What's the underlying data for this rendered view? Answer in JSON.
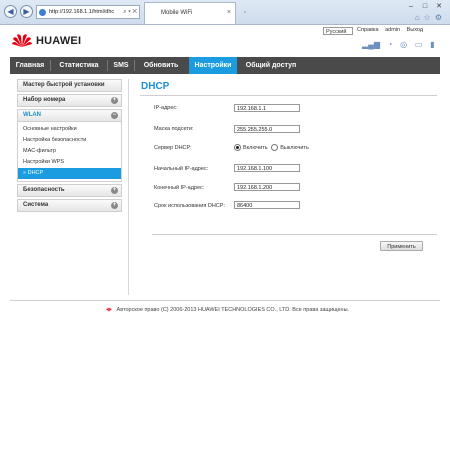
{
  "browser": {
    "address": "http://192.168.1.1/html/dhc",
    "tab_title": "Mobile WiFi",
    "minimize": "–",
    "maximize": "□",
    "close": "✕"
  },
  "header": {
    "logo_text": "HUAWEI",
    "language": "Русский",
    "links": [
      "Справка",
      "admin",
      "Выход"
    ]
  },
  "menu": [
    {
      "label": "Главная",
      "active": false
    },
    {
      "label": "Статистика",
      "active": false
    },
    {
      "label": "SMS",
      "active": false
    },
    {
      "label": "Обновить",
      "active": false
    },
    {
      "label": "Настройки",
      "active": true
    },
    {
      "label": "Общий доступ",
      "active": false
    }
  ],
  "sidebar": {
    "quick_setup": "Мастер быстрой установки",
    "dial": "Набор номера",
    "wlan": "WLAN",
    "wlan_items": [
      "Основные настройки",
      "Настройка безопасности",
      "MAC-фильтр",
      "Настройки WPS",
      "DHCP"
    ],
    "security": "Безопасность",
    "system": "Система"
  },
  "content": {
    "title": "DHCP",
    "ip_label": "IP-адрес:",
    "ip_value": "192.168.1.1",
    "mask_label": "Маска подсети:",
    "mask_value": "255.255.255.0",
    "dhcp_label": "Сервер DHCP:",
    "dhcp_on": "Включить",
    "dhcp_off": "Выключить",
    "start_label": "Начальный IP-адрес:",
    "start_value": "192.168.1.100",
    "end_label": "Конечный IP-адрес:",
    "end_value": "192.168.1.200",
    "lease_label": "Срок использования DHCP:",
    "lease_value": "86400",
    "apply": "Применить"
  },
  "footer": {
    "copyright": "Авторское право (C) 2006-2013 HUAWEI TECHNOLOGIES CO., LTD. Все права защищены."
  },
  "colors": {
    "accent": "#1b9be0",
    "menu_bg": "#4a4a4a",
    "brand_red": "#e60012"
  }
}
